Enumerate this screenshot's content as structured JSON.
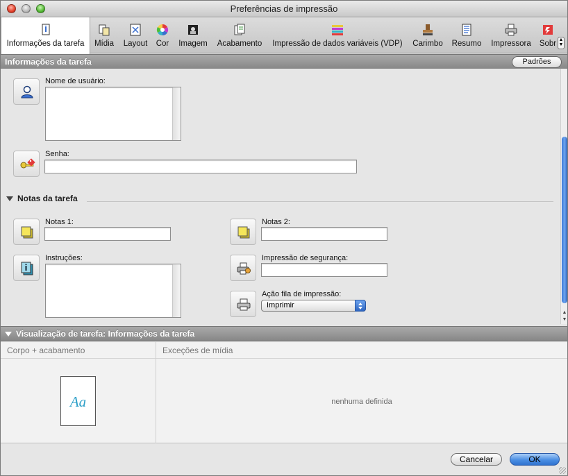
{
  "window": {
    "title": "Preferências de impressão"
  },
  "toolbar": {
    "tabs": [
      {
        "label": "Informações da tarefa",
        "icon": "job-info-icon",
        "active": true
      },
      {
        "label": "Mídia",
        "icon": "media-icon"
      },
      {
        "label": "Layout",
        "icon": "layout-icon"
      },
      {
        "label": "Cor",
        "icon": "color-wheel-icon"
      },
      {
        "label": "Imagem",
        "icon": "image-icon"
      },
      {
        "label": "Acabamento",
        "icon": "finishing-icon"
      },
      {
        "label": "Impressão de dados variáveis (VDP)",
        "icon": "vdp-icon"
      },
      {
        "label": "Carimbo",
        "icon": "stamp-icon"
      },
      {
        "label": "Resumo",
        "icon": "summary-icon"
      },
      {
        "label": "Impressora",
        "icon": "printer-icon"
      },
      {
        "label": "Sobr",
        "icon": "about-icon"
      }
    ]
  },
  "section": {
    "title": "Informações da tarefa",
    "defaults_label": "Padrões"
  },
  "form": {
    "username_label": "Nome de usuário:",
    "username_value": "",
    "password_label": "Senha:",
    "password_value": "",
    "notes_section": "Notas da tarefa",
    "notes1_label": "Notas 1:",
    "notes2_label": "Notas 2:",
    "instructions_label": "Instruções:",
    "secure_print_label": "Impressão de segurança:",
    "queue_action_label": "Ação fila de impressão:",
    "queue_action_value": "Imprimir"
  },
  "preview": {
    "title": "Visualização de tarefa: Informações da tarefa",
    "col1_header": "Corpo + acabamento",
    "col2_header": "Exceções de mídia",
    "paper_text": "Aa",
    "empty_text": "nenhuma definida"
  },
  "footer": {
    "cancel_label": "Cancelar",
    "ok_label": "OK"
  },
  "colors": {
    "accent": "#3a78d8",
    "header_gray": "#8a8a8a"
  }
}
